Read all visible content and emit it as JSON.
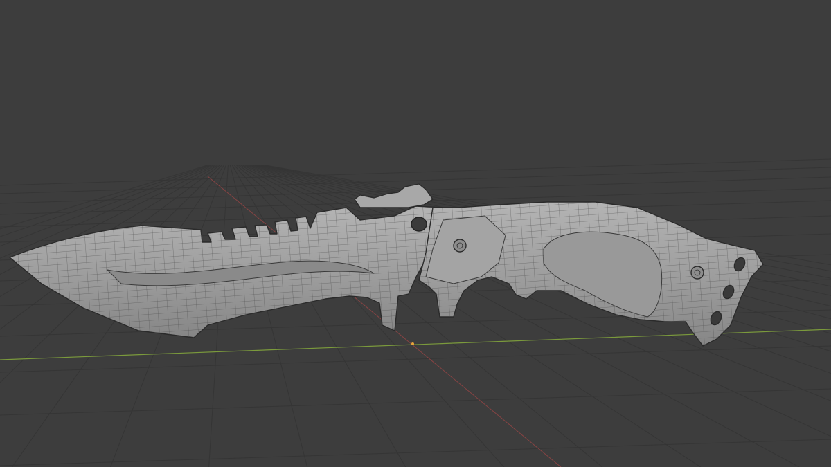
{
  "scene": {
    "background_color": "#3d3d3d",
    "grid_color": "#353535",
    "x_axis_color": "#7b9a3c",
    "y_axis_color": "#9a4545",
    "object": "combat-knife",
    "shading": "solid-with-wireframe",
    "mesh_fill_color": "#9b9b9b",
    "mesh_edge_color": "#3c3c3c",
    "outline_color": "#222222"
  }
}
